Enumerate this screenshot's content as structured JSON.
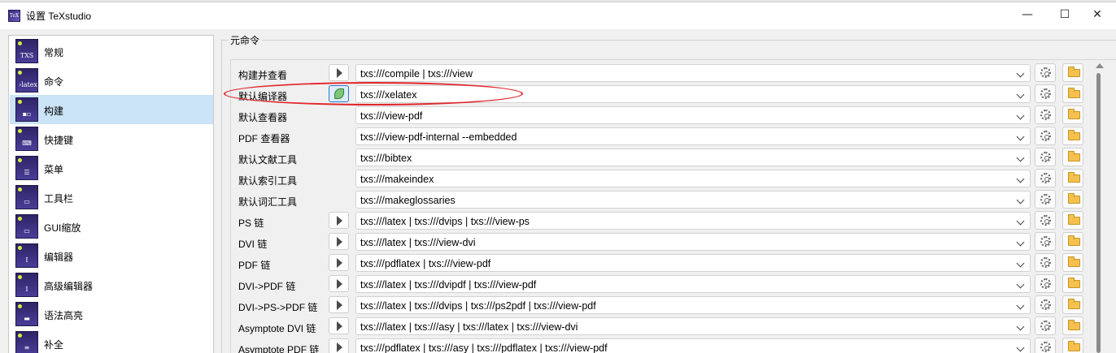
{
  "window": {
    "title": "设置 TeXstudio",
    "app_icon": "texstudio-logo-icon",
    "controls": [
      "—",
      "☐",
      "✕"
    ]
  },
  "sidebar": {
    "items": [
      {
        "label": "常规",
        "icon": "general-icon",
        "glyph": "TXS",
        "selected": false
      },
      {
        "label": "命令",
        "icon": "command-icon",
        "glyph": "›latex",
        "selected": false
      },
      {
        "label": "构建",
        "icon": "build-icon",
        "glyph": "▪▫",
        "selected": true
      },
      {
        "label": "快捷键",
        "icon": "keyboard-icon",
        "glyph": "⌨",
        "selected": false
      },
      {
        "label": "菜单",
        "icon": "menu-icon",
        "glyph": "☰",
        "selected": false
      },
      {
        "label": "工具栏",
        "icon": "toolbar-icon",
        "glyph": "▭",
        "selected": false
      },
      {
        "label": "GUI缩放",
        "icon": "gui-scale-icon",
        "glyph": "▭",
        "selected": false
      },
      {
        "label": "编辑器",
        "icon": "editor-icon",
        "glyph": "I",
        "selected": false
      },
      {
        "label": "高级编辑器",
        "icon": "advanced-editor-icon",
        "glyph": "I",
        "selected": false
      },
      {
        "label": "语法高亮",
        "icon": "syntax-highlight-icon",
        "glyph": "▬",
        "selected": false
      },
      {
        "label": "补全",
        "icon": "completion-icon",
        "glyph": "≡",
        "selected": false
      }
    ]
  },
  "meta_commands": {
    "group_title": "元命令",
    "rows": [
      {
        "label": "构建并查看",
        "value": "txs:///compile | txs:///view",
        "has_run": true,
        "run_active": false
      },
      {
        "label": "默认编译器",
        "value": "txs:///xelatex",
        "has_run": true,
        "run_active": true
      },
      {
        "label": "默认查看器",
        "value": "txs:///view-pdf",
        "has_run": false,
        "run_active": false
      },
      {
        "label": "PDF 查看器",
        "value": "txs:///view-pdf-internal --embedded",
        "has_run": false,
        "run_active": false
      },
      {
        "label": "默认文献工具",
        "value": "txs:///bibtex",
        "has_run": false,
        "run_active": false
      },
      {
        "label": "默认索引工具",
        "value": "txs:///makeindex",
        "has_run": false,
        "run_active": false
      },
      {
        "label": "默认词汇工具",
        "value": "txs:///makeglossaries",
        "has_run": false,
        "run_active": false
      },
      {
        "label": "PS 链",
        "value": "txs:///latex | txs:///dvips | txs:///view-ps",
        "has_run": true,
        "run_active": false
      },
      {
        "label": "DVI 链",
        "value": "txs:///latex | txs:///view-dvi",
        "has_run": true,
        "run_active": false
      },
      {
        "label": "PDF 链",
        "value": "txs:///pdflatex | txs:///view-pdf",
        "has_run": true,
        "run_active": false
      },
      {
        "label": "DVI->PDF 链",
        "value": "txs:///latex | txs:///dvipdf | txs:///view-pdf",
        "has_run": true,
        "run_active": false
      },
      {
        "label": "DVI->PS->PDF 链",
        "value": "txs:///latex | txs:///dvips | txs:///ps2pdf | txs:///view-pdf",
        "has_run": true,
        "run_active": false
      },
      {
        "label": "Asymptote DVI 链",
        "value": "txs:///latex | txs:///asy | txs:///latex | txs:///view-dvi",
        "has_run": true,
        "run_active": false
      },
      {
        "label": "Asymptote PDF 链",
        "value": "txs:///pdflatex | txs:///asy | txs:///pdflatex | txs:///view-pdf",
        "has_run": true,
        "run_active": false
      }
    ]
  },
  "annotation": {
    "color": "#e0262b",
    "target_row": 1
  }
}
